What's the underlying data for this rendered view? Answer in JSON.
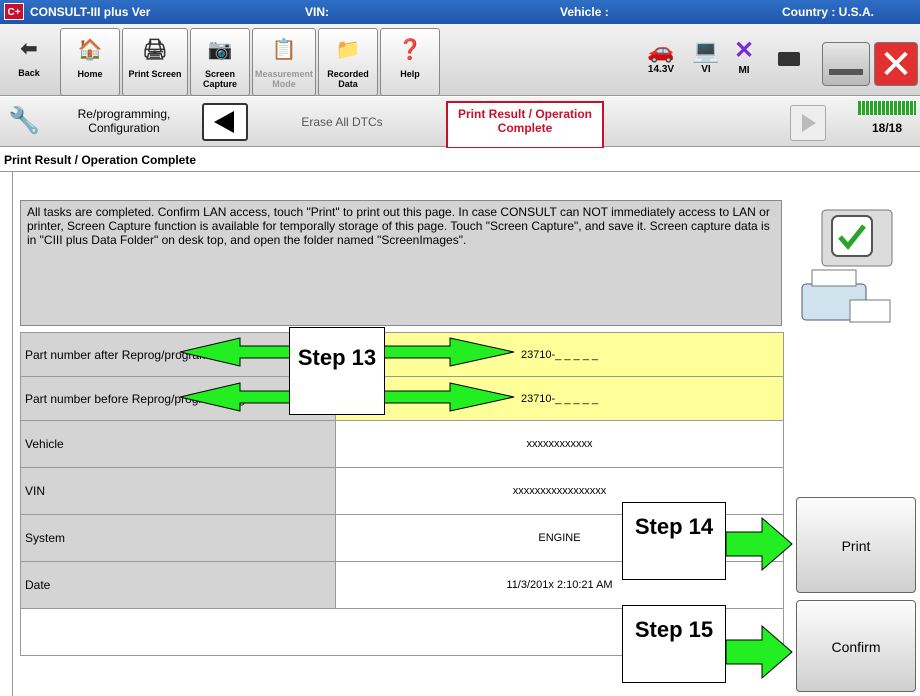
{
  "titlebar": {
    "logo": "C+",
    "app": "CONSULT-III plus  Ver",
    "vin_label": "VIN:",
    "vehicle_label": "Vehicle :",
    "country": "Country : U.S.A."
  },
  "toolbar": {
    "back": "Back",
    "home": "Home",
    "print_screen": "Print Screen",
    "screen_capture": "Screen Capture",
    "measurement_mode": "Measurement Mode",
    "recorded_data": "Recorded Data",
    "help": "Help",
    "voltage": "14.3V",
    "vi": "VI",
    "mi": "MI"
  },
  "nav": {
    "reprog": "Re/programming, Configuration",
    "erase": "Erase All DTCs",
    "current": "Print Result / Operation Complete",
    "progress": "18/18"
  },
  "section_title": "Print Result / Operation Complete",
  "message": "All tasks are completed. Confirm LAN access, touch \"Print\" to print out this page. In case CONSULT can NOT immediately access to LAN or printer, Screen Capture function is available for temporally storage of this page. Touch \"Screen Capture\", and save it. Screen capture data is in \"CIII plus Data Folder\" on desk top, and open the folder named \"ScreenImages\".",
  "rows": [
    {
      "label": "Part number after Reprog/programming",
      "value": "23710-_ _ _ _ _"
    },
    {
      "label": "Part number before Reprog/programming",
      "value": "23710-_ _ _ _ _"
    },
    {
      "label": "Vehicle",
      "value": "xxxxxxxxxxxx"
    },
    {
      "label": "VIN",
      "value": "xxxxxxxxxxxxxxxxx"
    },
    {
      "label": "System",
      "value": "ENGINE"
    },
    {
      "label": "Date",
      "value": "11/3/201x 2:10:21 AM"
    }
  ],
  "steps": {
    "s13": "Step 13",
    "s14": "Step 14",
    "s15": "Step 15"
  },
  "buttons": {
    "print": "Print",
    "confirm": "Confirm"
  },
  "colors": {
    "highlight": "#ffff99",
    "arrow": "#22ee22",
    "current_border": "#c8102e"
  }
}
